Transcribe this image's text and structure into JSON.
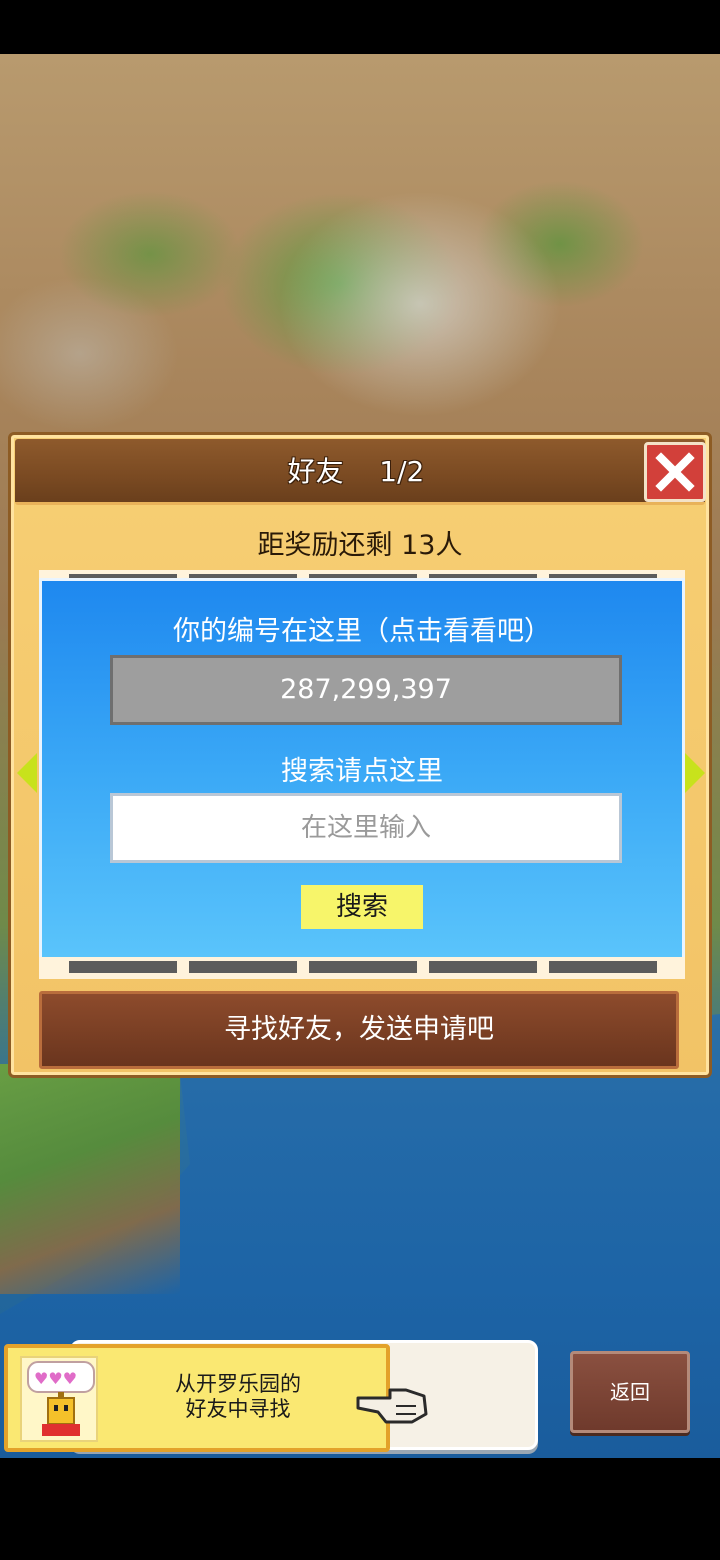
{
  "dialog": {
    "title": "好友    1/2",
    "reward_text": "距奖励还剩 13人",
    "id_label": "你的编号在这里（点击看看吧）",
    "player_id": "287,299,397",
    "search_label": "搜索请点这里",
    "search_placeholder": "在这里输入",
    "search_button": "搜索",
    "find_button": "寻找好友，发送申请吧"
  },
  "bottom": {
    "kairo_text_line1": "从开罗乐园的",
    "kairo_text_line2": "好友中寻找",
    "back_button": "返回"
  },
  "icons": {
    "close": "close-icon",
    "prev": "arrow-left-icon",
    "next": "arrow-right-icon",
    "mascot": "kairobot-icon",
    "hand": "pointing-hand-icon"
  },
  "colors": {
    "panel_blue": "#1e88ef",
    "close_red": "#d2403a",
    "button_brown": "#7a3f24",
    "search_yellow": "#f7f56a",
    "arrow_green": "#c8e21c"
  }
}
